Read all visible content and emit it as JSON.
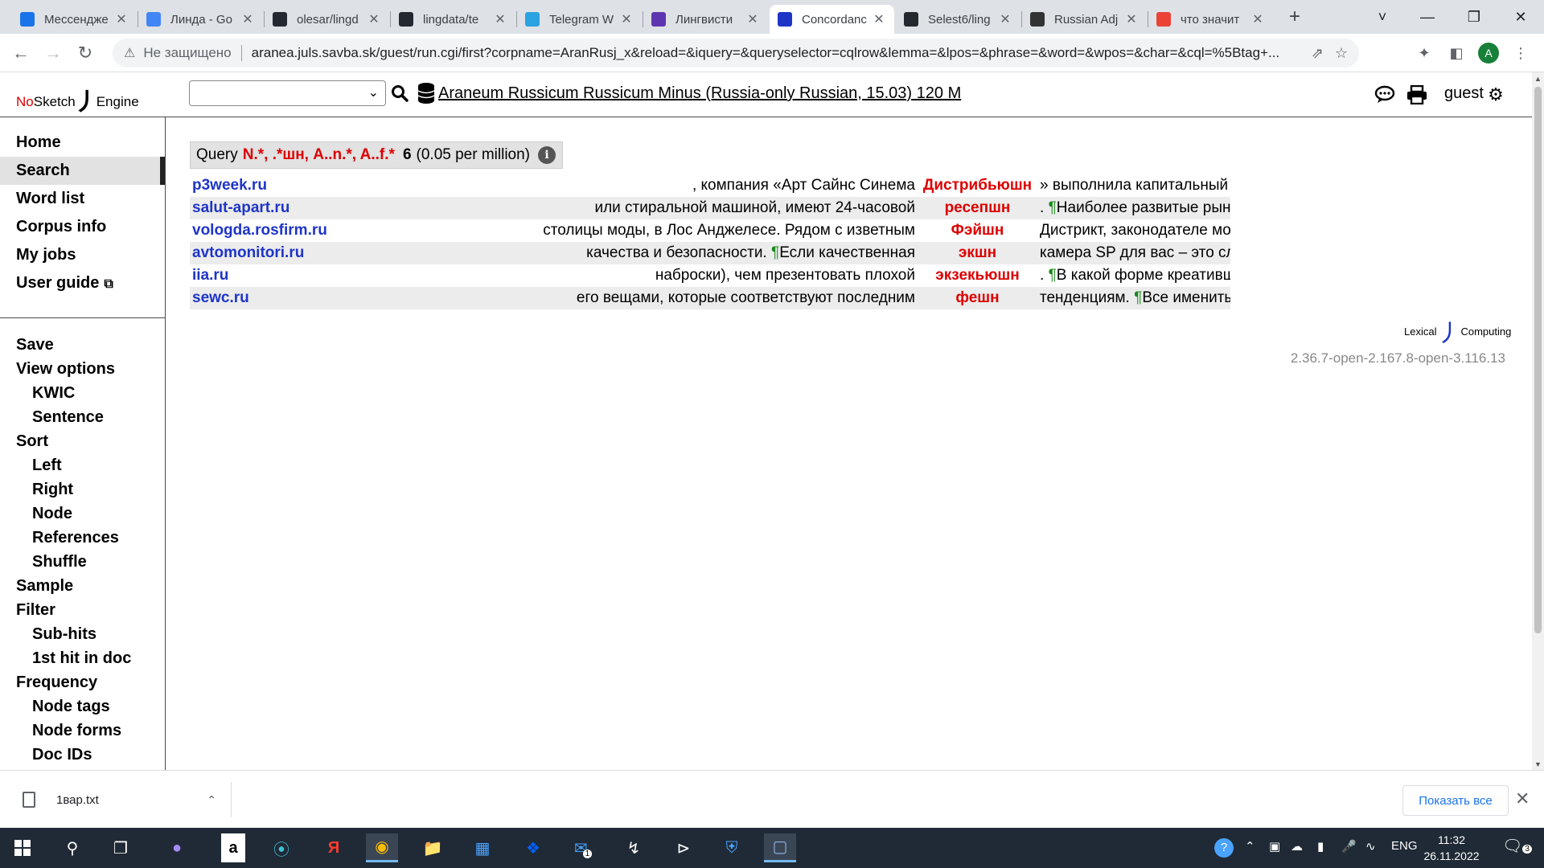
{
  "browser": {
    "tabs": [
      {
        "title": "Мессендже",
        "favicon_color": "#1a73e8"
      },
      {
        "title": "Линда - Go",
        "favicon_color": "#4285f4"
      },
      {
        "title": "olesar/lingd",
        "favicon_color": "#24292f"
      },
      {
        "title": "lingdata/te",
        "favicon_color": "#24292f"
      },
      {
        "title": "Telegram W",
        "favicon_color": "#2aa3e0"
      },
      {
        "title": "Лингвисти",
        "favicon_color": "#5e35b1"
      },
      {
        "title": "Concordanc",
        "favicon_color": "#1e35c8",
        "active": true
      },
      {
        "title": "Selest6/ling",
        "favicon_color": "#24292f"
      },
      {
        "title": "Russian Adj",
        "favicon_color": "#333333"
      },
      {
        "title": "что значит",
        "favicon_color": "#ea4335"
      }
    ],
    "address": {
      "security_label": "Не защищено",
      "url": "aranea.juls.savba.sk/guest/run.cgi/first?corpname=AranRusj_x&reload=&iquery=&queryselector=cqlrow&lemma=&lpos=&phrase=&word=&wpos=&char=&cql=%5Btag+..."
    },
    "profile_initial": "A"
  },
  "app": {
    "logo": {
      "no": "No",
      "sketch": "Sketch",
      "engine": "Engine"
    },
    "corpus_select_value": "",
    "corpus_name": "Araneum Russicum Russicum Minus (Russia-only Russian, 15.03) 120 M",
    "user": "guest"
  },
  "sidebar": {
    "menu1": [
      "Home",
      "Search",
      "Word list",
      "Corpus info",
      "My jobs",
      "User guide"
    ],
    "menu2": [
      {
        "label": "Save",
        "sub": false
      },
      {
        "label": "View options",
        "sub": false
      },
      {
        "label": "KWIC",
        "sub": true
      },
      {
        "label": "Sentence",
        "sub": true
      },
      {
        "label": "Sort",
        "sub": false
      },
      {
        "label": "Left",
        "sub": true
      },
      {
        "label": "Right",
        "sub": true
      },
      {
        "label": "Node",
        "sub": true
      },
      {
        "label": "References",
        "sub": true
      },
      {
        "label": "Shuffle",
        "sub": true
      },
      {
        "label": "Sample",
        "sub": false
      },
      {
        "label": "Filter",
        "sub": false
      },
      {
        "label": "Sub-hits",
        "sub": true
      },
      {
        "label": "1st hit in doc",
        "sub": true
      },
      {
        "label": "Frequency",
        "sub": false
      },
      {
        "label": "Node tags",
        "sub": true
      },
      {
        "label": "Node forms",
        "sub": true
      },
      {
        "label": "Doc IDs",
        "sub": true
      },
      {
        "label": "Collocations",
        "sub": false
      }
    ]
  },
  "query": {
    "label": "Query",
    "expression": "N.*, .*шн, A..n.*, A..f.*",
    "count": "6",
    "relative": "(0.05 per million)"
  },
  "kwic": [
    {
      "ref": "p3week.ru",
      "left": ", компания «Арт Сайнс Синема",
      "node": "Дистрибьюшн",
      "right": "» выполнила капитальный ремонт ДК «Россия» в",
      "right_para": false
    },
    {
      "ref": "salut-apart.ru",
      "left": "или стиральной машиной, имеют 24-часовой",
      "node": "ресепшн",
      "right": ". ",
      "right_para": true,
      "right_after": "Наиболее развитые рынки, располагающие"
    },
    {
      "ref": "vologda.rosfirm.ru",
      "left": "столицы моды, в Лос Анджелесе. Рядом с изветным",
      "node": "Фэйшн",
      "right": "Дистрикт, законодателе мод, откуда мы и",
      "right_para": false
    },
    {
      "ref": "avtomonitori.ru",
      "left_before": "качества и безопасности. ",
      "left_para": true,
      "left": "Если качественная",
      "node": "экшн",
      "right": "камера SP для вас – это сложный выбор, то наши",
      "right_para": false
    },
    {
      "ref": "iia.ru",
      "left": "наброски), чем презентовать плохой",
      "node": "экзекьюшн",
      "right": ". ",
      "right_para": true,
      "right_after": "В какой форме креативщики предлагают идеи?"
    },
    {
      "ref": "sewc.ru",
      "left": "его вещами, которые соответствуют последним",
      "node": "фешн",
      "right": "тенденциям. ",
      "right_para": true,
      "right_after": "Все именитые дизайнеры уже"
    }
  ],
  "footer": {
    "lc_logo_left": "Lexical",
    "lc_logo_right": "Computing",
    "version": "2.36.7-open-2.167.8-open-3.116.13"
  },
  "downloads": {
    "file": "1вар.txt",
    "show_all": "Показать все"
  },
  "taskbar": {
    "lang": "ENG",
    "time": "11:32",
    "date": "26.11.2022",
    "mail_badge": "1",
    "notif_badge": "3"
  }
}
